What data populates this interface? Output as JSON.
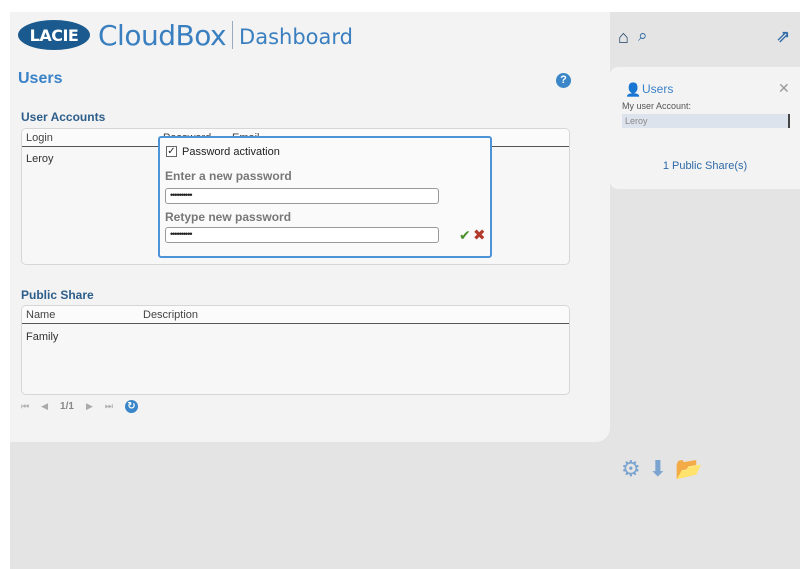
{
  "header": {
    "brand": "LACIE",
    "product": "CloudBox",
    "section": "Dashboard"
  },
  "page": {
    "title": "Users",
    "help_icon": "?"
  },
  "user_accounts": {
    "title": "User Accounts",
    "columns": [
      "Login",
      "Password",
      "Email"
    ],
    "rows": [
      {
        "login": "Leroy"
      }
    ],
    "editor": {
      "checkbox_label": "Password activation",
      "checked": true,
      "new_password_label": "Enter a new password",
      "new_password_value": "••••••••••",
      "retype_label": "Retype new password",
      "retype_value": "••••••••••"
    }
  },
  "public_share": {
    "title": "Public Share",
    "columns": [
      "Name",
      "Description"
    ],
    "rows": [
      {
        "name": "Family"
      }
    ]
  },
  "pager": {
    "page_text": "1/1"
  },
  "side_panel": {
    "title": "Users",
    "account_label": "My user Account:",
    "account_value": "Leroy",
    "shares_link": "1 Public Share(s)"
  },
  "colors": {
    "accent": "#3a82c8",
    "brand": "#1b5a8e",
    "ok": "#4a8f2a",
    "cancel": "#b23b2c"
  }
}
